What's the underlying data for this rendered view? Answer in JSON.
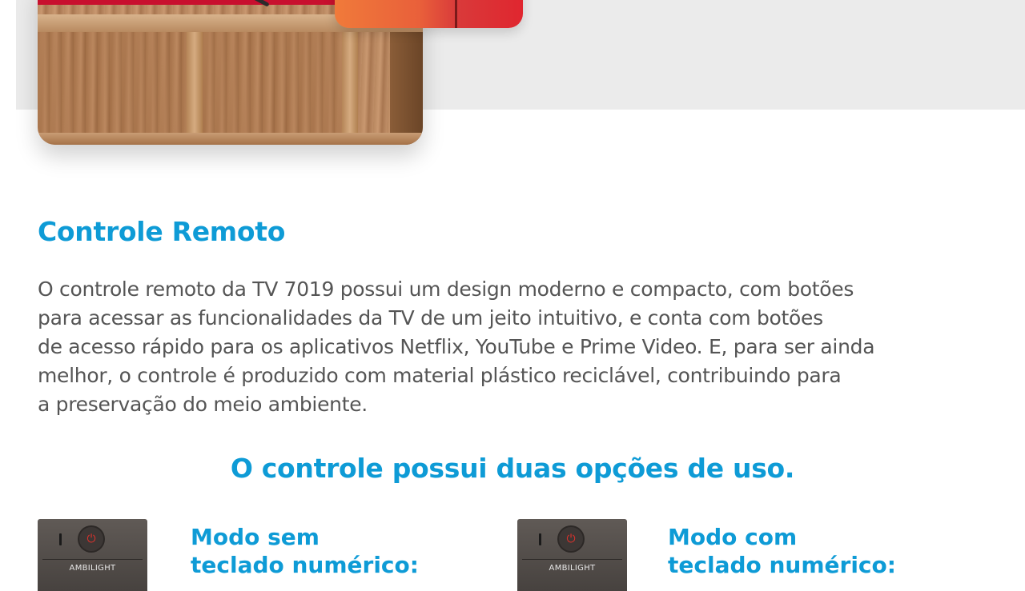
{
  "hero": {
    "image": "tv-on-wooden-stand"
  },
  "section": {
    "title": "Controle Remoto",
    "paragraph_lines": [
      "O controle remoto da TV 7019 possui um design moderno e compacto, com botões",
      "para acessar as funcionalidades da TV de um jeito intuitivo, e conta com botões",
      "de acesso rápido para os aplicativos Netflix, YouTube e Prime Video. E, para ser ainda",
      "melhor, o controle é produzido com material plástico reciclável, contribuindo para",
      "a preservação do meio ambiente."
    ]
  },
  "usage": {
    "heading": "O controle possui duas opções de uso.",
    "modes": [
      {
        "title_lines": [
          "Modo sem",
          "teclado numérico:"
        ],
        "remote_label": "AMBILIGHT",
        "remote_icon": "power-icon"
      },
      {
        "title_lines": [
          "Modo com",
          "teclado numérico:"
        ],
        "remote_label": "AMBILIGHT",
        "remote_icon": "power-icon"
      }
    ]
  },
  "colors": {
    "accent": "#0e9bd6",
    "body_text": "#555555",
    "band": "#ebebeb",
    "power_red": "#e0312c"
  }
}
